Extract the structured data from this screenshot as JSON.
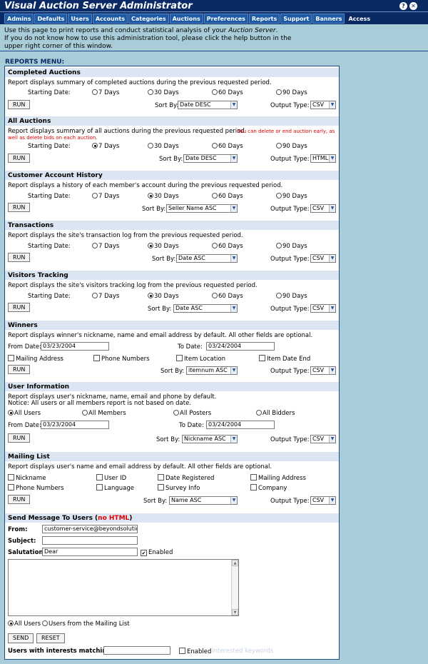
{
  "app": {
    "title": "Visual Auction Server Administrator"
  },
  "tabs": [
    "Admins",
    "Defaults",
    "Users",
    "Accounts",
    "Categories",
    "Auctions",
    "Preferences",
    "Reports",
    "Support",
    "Banners",
    "Access"
  ],
  "intro": {
    "line1_prefix": "Use this page to print reports and conduct statistical analysis of your ",
    "line1_em": "Auction Server",
    "line1_suffix": ".",
    "line2": "If you do not know how to use this administration tool, please click the help button in the",
    "line3": "upper right corner of this window."
  },
  "menu_title": "REPORTS MENU:",
  "common": {
    "starting_date": "Starting Date:",
    "sort_by": "Sort By:",
    "output_type": "Output Type:",
    "run": "RUN",
    "from_date": "From Date:",
    "to_date": "To Date:",
    "days7": "7 Days",
    "days30": "30 Days",
    "days60": "60 Days",
    "days90": "90 Days"
  },
  "completed": {
    "title": "Completed Auctions",
    "desc": "Report displays summary of completed auctions during the previous requested period.",
    "sort": "Date DESC",
    "output": "CSV"
  },
  "all_auctions": {
    "title": "All Auctions",
    "desc": "Report displays summary of all auctions during the previous requested period.",
    "note1": "You can delete or end auction early, as",
    "note2": "well as delete bids on each auction.",
    "sort": "Date DESC",
    "output": "HTML"
  },
  "customer": {
    "title": "Customer Account History",
    "desc": "Report displays a history of each member's account during the previous requested period.",
    "sort": "Seller Name ASC",
    "output": "CSV"
  },
  "transactions": {
    "title": "Transactions",
    "desc": "Report displays the site's transaction log from the previous requested period.",
    "sort": "Date ASC",
    "output": "CSV"
  },
  "visitors": {
    "title": "Visitors Tracking",
    "desc": "Report displays the site's visitors tracking log from the previous requested period.",
    "sort": "Date ASC",
    "output": "CSV"
  },
  "winners": {
    "title": "Winners",
    "desc": "Report displays winner's nickname, name and email address by default. All other fields are optional.",
    "from": "03/23/2004",
    "to": "03/24/2004",
    "opt1": "Mailing Address",
    "opt2": "Phone Numbers",
    "opt3": "Item Location",
    "opt4": "Item Date End",
    "sort": "itemnum ASC",
    "output": "CSV"
  },
  "userinfo": {
    "title": "User Information",
    "desc1": "Report displays user's nickname, name, email and phone by default.",
    "desc2": "Notice:  All users or all members report is not based on date.",
    "r1": "All Users",
    "r2": "All Members",
    "r3": "All Posters",
    "r4": "All Bidders",
    "from": "03/23/2004",
    "to": "03/24/2004",
    "sort": "Nickname ASC",
    "output": "CSV"
  },
  "mailing": {
    "title": "Mailing List",
    "desc": "Report displays user's name and email address by default. All other fields are optional.",
    "o1": "Nickname",
    "o2": "User ID",
    "o3": "Date Registered",
    "o4": "Mailing Address",
    "o5": "Phone Numbers",
    "o6": "Language",
    "o7": "Survey Info",
    "o8": "Company",
    "sort": "Name ASC",
    "output": "CSV"
  },
  "message": {
    "title_prefix": "Send Message To Users (",
    "title_red": "no HTML",
    "title_suffix": ")",
    "from_label": "From:",
    "from_value": "customer-service@beyondsolutions.",
    "subject_label": "Subject:",
    "salutation_label": "Salutation:",
    "salutation_value": "Dear",
    "enabled": "Enabled",
    "rcpt1": "All Users",
    "rcpt2": "Users from the Mailing List",
    "send": "SEND",
    "reset": "RESET",
    "interests_label": "Users with interests matching:",
    "interests_enabled": "Enabled",
    "interests_hint": "Interested keywords"
  }
}
